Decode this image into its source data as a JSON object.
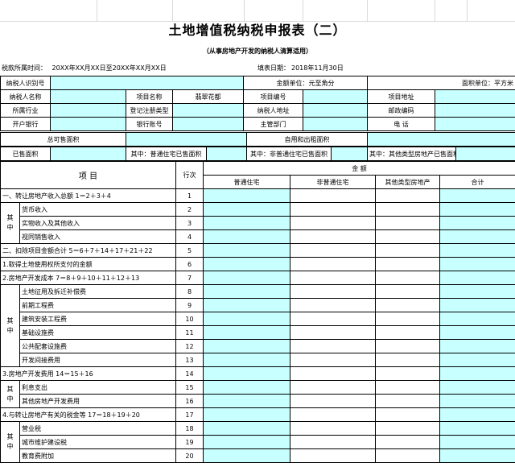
{
  "title": "土地增值税纳税申报表（二）",
  "subtitle": "（从事房地产开发的纳税人清算适用）",
  "period_label": "税款所属时间：",
  "period_value": "20XX年XX月XX日至20XX年XX月XX日",
  "fill_date_label": "填表日期：",
  "fill_date_value": "2018年11月30日",
  "row_taxpayer_id": {
    "label": "纳税人识别号",
    "amount_unit": "金额单位：元至角分",
    "area_unit": "面积单位：平方米"
  },
  "row_name": {
    "c1": "纳税人名称",
    "c2": "项目名称",
    "c3": "翡翠花都",
    "c4": "项目编号",
    "c5": "项目地址"
  },
  "row_industry": {
    "c1": "所属行业",
    "c2": "登记注册类型",
    "c3": "纳税人地址",
    "c4": "邮政编码"
  },
  "row_bank": {
    "c1": "开户银行",
    "c2": "银行账号",
    "c3": "主管部门",
    "c4": "电  话"
  },
  "area_row1": {
    "total_sold": "总可售面积",
    "self_used": "自用和出租面积"
  },
  "area_row2": {
    "sold": "已售面积",
    "ordinary": "其中：普通住宅已售面积",
    "non_ordinary": "其中：非普通住宅已售面积",
    "other": "其中：其他类型房地产已售面积"
  },
  "header": {
    "item": "项                  目",
    "line_no": "行次",
    "amount": "金      额",
    "ordinary": "普通住宅",
    "non_ordinary": "非普通住宅",
    "other": "其他类型房地产",
    "total": "合计"
  },
  "qi_zhong": "其中",
  "rows": [
    {
      "label": "一、转让房地产收入总额    1＝2＋3＋4",
      "no": "1"
    },
    {
      "label": "货币收入",
      "no": "2"
    },
    {
      "label": "实物收入及其他收入",
      "no": "3"
    },
    {
      "label": "视同销售收入",
      "no": "4"
    },
    {
      "label": "二、扣除项目金额合计    5＝6＋7＋14＋17＋21＋22",
      "no": "5"
    },
    {
      "label": "1.取得土地使用权所支付的金额",
      "no": "6"
    },
    {
      "label": "2.房地产开发成本    7＝8＋9＋10＋11＋12＋13",
      "no": "7"
    },
    {
      "label": "土地征用及拆迁补偿费",
      "no": "8"
    },
    {
      "label": "前期工程费",
      "no": "9"
    },
    {
      "label": "建筑安装工程费",
      "no": "10"
    },
    {
      "label": "基础设施费",
      "no": "11"
    },
    {
      "label": "公共配套设施费",
      "no": "12"
    },
    {
      "label": "开发间接费用",
      "no": "13"
    },
    {
      "label": "3.房地产开发费用  14＝15＋16",
      "no": "14"
    },
    {
      "label": "利息支出",
      "no": "15"
    },
    {
      "label": "其他房地产开发费用",
      "no": "16"
    },
    {
      "label": "4.与转让房地产有关的税金等     17＝18＋19＋20",
      "no": "17"
    },
    {
      "label": "营业税",
      "no": "18"
    },
    {
      "label": "城市维护建设税",
      "no": "19"
    },
    {
      "label": "教育费附加",
      "no": "20"
    }
  ]
}
